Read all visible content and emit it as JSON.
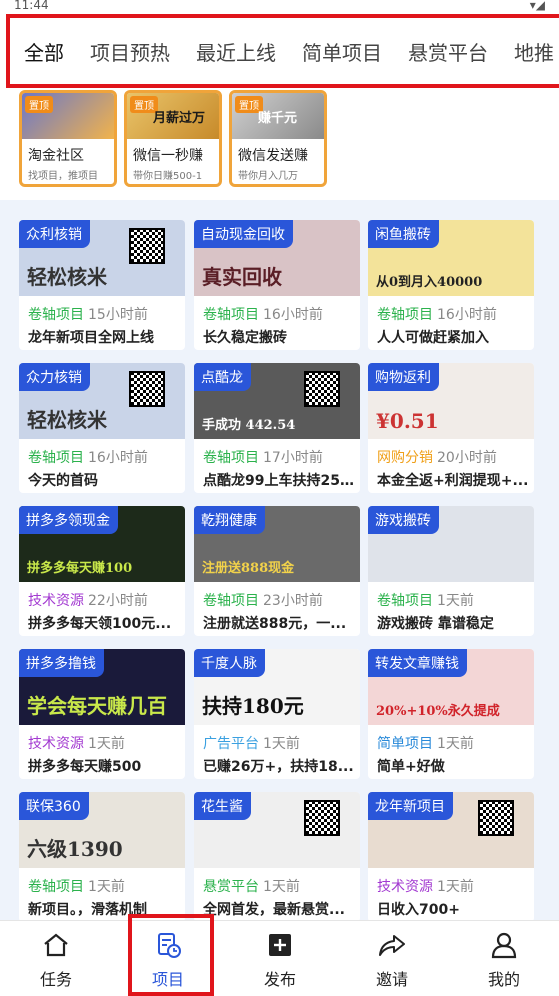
{
  "status": {
    "time": "11:44",
    "right": "▾◢"
  },
  "tabs": [
    "全部",
    "项目预热",
    "最近上线",
    "简单项目",
    "悬赏平台",
    "地推"
  ],
  "featured": [
    {
      "badge": "置顶",
      "art": "",
      "name": "淘金社区",
      "desc": "找项目，推项目"
    },
    {
      "badge": "置顶",
      "art": "月薪过万",
      "name": "微信一秒赚",
      "desc": "带你日赚500-1"
    },
    {
      "badge": "置顶",
      "art": "赚千元",
      "name": "微信发送赚",
      "desc": "带你月入几万"
    }
  ],
  "cards": [
    {
      "tag": "众利核销",
      "cat": "卷轴项目",
      "cat_color": "#2bb24c",
      "time": "15小时前",
      "title": "龙年新项目全网上线",
      "big": "轻松核米",
      "bg": "#c9d4e8",
      "big_color": "#333"
    },
    {
      "tag": "自动现金回收",
      "cat": "卷轴项目",
      "cat_color": "#2bb24c",
      "time": "16小时前",
      "title": "长久稳定搬砖",
      "big": "真实回收",
      "bg": "#d9c3c6",
      "big_color": "#5a1e26"
    },
    {
      "tag": "闲鱼搬砖",
      "cat": "卷轴项目",
      "cat_color": "#2bb24c",
      "time": "16小时前",
      "title": "人人可做赶紧加入",
      "big": "从0到月入40000",
      "bg": "#f3e39a",
      "big_color": "#222"
    },
    {
      "tag": "众力核销",
      "cat": "卷轴项目",
      "cat_color": "#2bb24c",
      "time": "16小时前",
      "title": "今天的首码",
      "big": "轻松核米",
      "bg": "#c9d4e8",
      "big_color": "#333"
    },
    {
      "tag": "点酷龙",
      "cat": "卷轴项目",
      "cat_color": "#2bb24c",
      "time": "17小时前",
      "title": "点酷龙99上车扶持25...",
      "big": "手成功 442.54",
      "bg": "#5a5a5a",
      "big_color": "#fff"
    },
    {
      "tag": "购物返利",
      "cat": "网购分销",
      "cat_color": "#f0a01a",
      "time": "20小时前",
      "title": "本金全返+利润提现+...",
      "big": "¥0.51",
      "bg": "#f1ece8",
      "big_color": "#c33"
    },
    {
      "tag": "拼多多领现金",
      "cat": "技术资源",
      "cat_color": "#a33ad1",
      "time": "22小时前",
      "title": "拼多多每天领100元...",
      "big": "拼多多每天赚100",
      "bg": "#1d2a1a",
      "big_color": "#c9e84a"
    },
    {
      "tag": "乾翔健康",
      "cat": "卷轴项目",
      "cat_color": "#2bb24c",
      "time": "23小时前",
      "title": "注册就送888元，一...",
      "big": "注册送888现金",
      "bg": "#6a6a6a",
      "big_color": "#f2d24a"
    },
    {
      "tag": "游戏搬砖",
      "cat": "卷轴项目",
      "cat_color": "#2bb24c",
      "time": "1天前",
      "title": "游戏搬砖 靠谱稳定",
      "big": "",
      "bg": "#dfe3ea",
      "big_color": "#333"
    },
    {
      "tag": "拼多多撸钱",
      "cat": "技术资源",
      "cat_color": "#a33ad1",
      "time": "1天前",
      "title": "拼多多每天赚500",
      "big": "学会每天赚几百",
      "bg": "#1a1a3a",
      "big_color": "#c9e84a"
    },
    {
      "tag": "千度人脉",
      "cat": "广告平台",
      "cat_color": "#3aa0e0",
      "time": "1天前",
      "title": "已赚26万+，扶持18...",
      "big": "扶持180元",
      "bg": "#f4f4f4",
      "big_color": "#111"
    },
    {
      "tag": "转发文章赚钱",
      "cat": "简单项目",
      "cat_color": "#2a8ad9",
      "time": "1天前",
      "title": "简单+好做",
      "big": "20%+10%永久提成",
      "bg": "#f3d6d6",
      "big_color": "#d1232a"
    },
    {
      "tag": "联保360",
      "cat": "卷轴项目",
      "cat_color": "#2bb24c",
      "time": "1天前",
      "title": "新项目。，滑落机制",
      "big": "六级1390",
      "bg": "#e8e4dc",
      "big_color": "#333"
    },
    {
      "tag": "花生酱",
      "cat": "悬赏平台",
      "cat_color": "#2bb24c",
      "time": "1天前",
      "title": "全网首发，最新悬赏...",
      "big": "",
      "bg": "#efefef",
      "big_color": "#333"
    },
    {
      "tag": "龙年新项目",
      "cat": "技术资源",
      "cat_color": "#a33ad1",
      "time": "1天前",
      "title": "日收入700+",
      "big": "",
      "bg": "#e8dcd0",
      "big_color": "#333"
    }
  ],
  "nav": [
    {
      "label": "任务",
      "icon": "home-icon"
    },
    {
      "label": "项目",
      "icon": "project-icon"
    },
    {
      "label": "发布",
      "icon": "publish-icon"
    },
    {
      "label": "邀请",
      "icon": "share-icon"
    },
    {
      "label": "我的",
      "icon": "user-icon"
    }
  ],
  "colors": {
    "accent": "#2a56d9",
    "highlight": "#e0151b",
    "featured_border": "#f0a43a",
    "grid_bg": "#eef3fb"
  }
}
